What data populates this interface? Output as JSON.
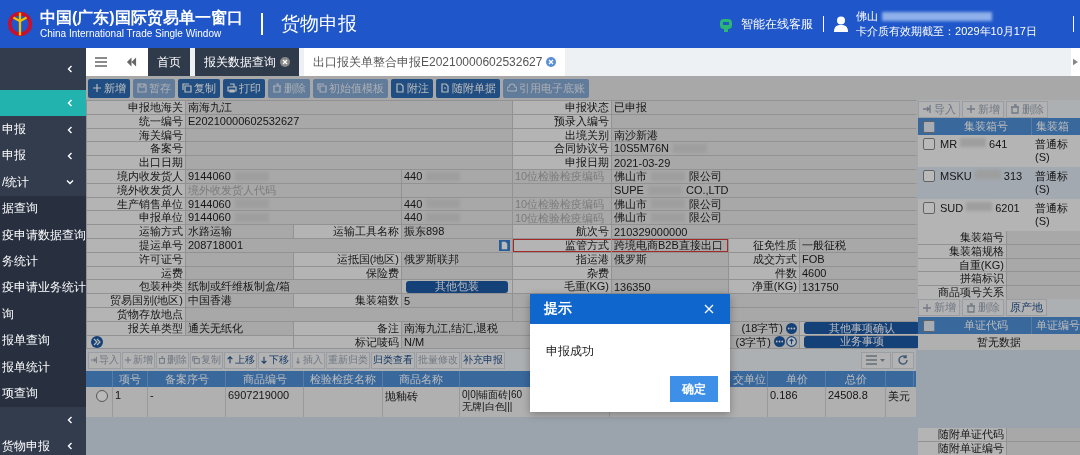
{
  "header": {
    "title": "中国(广东)国际贸易单一窗口",
    "subtitle": "China International Trade Single Window",
    "module": "货物申报",
    "service": "智能在线客服",
    "user": "佛山",
    "user_redacted": true,
    "card_expiry": "卡介质有效期截至：2029年10月17日"
  },
  "sidebar": {
    "items": [
      {
        "selected": false,
        "expanded": false
      },
      {
        "selected": true,
        "expanded": false
      },
      {
        "label": "申报",
        "selected": false,
        "expanded": false
      },
      {
        "label": "申报",
        "selected": false,
        "expanded": false
      },
      {
        "label": "/统计",
        "selected": false,
        "expanded": true,
        "children": [
          {
            "label": "据查询",
            "selected": false
          },
          {
            "label": "疫申请数据查询",
            "selected": false
          },
          {
            "label": "务统计",
            "selected": false
          },
          {
            "label": "疫申请业务统计",
            "selected": false
          },
          {
            "label": "询",
            "selected": false
          },
          {
            "label": "报单查询",
            "selected": false
          },
          {
            "label": "报单统计",
            "selected": false
          },
          {
            "label": "项查询",
            "selected": false
          }
        ]
      },
      {
        "selected": false,
        "expanded": false
      },
      {
        "label": "货物申报",
        "selected": false,
        "expanded": false
      }
    ]
  },
  "tabs": [
    {
      "label": "首页",
      "selected": false,
      "closable": false
    },
    {
      "label": "报关数据查询",
      "selected": false,
      "closable": true
    },
    {
      "label": "出口报关单整合申报E20210000602532627",
      "selected": true,
      "closable": true
    }
  ],
  "toolbar": [
    {
      "label": "新增",
      "disabled": false
    },
    {
      "label": "暂存",
      "disabled": true
    },
    {
      "label": "复制",
      "disabled": false
    },
    {
      "label": "打印",
      "disabled": false
    },
    {
      "label": "删除",
      "disabled": true
    },
    {
      "label": "初始值模板",
      "disabled": true
    },
    {
      "label": "附注",
      "disabled": false
    },
    {
      "label": "随附单据",
      "disabled": false
    },
    {
      "label": "引用电子底账",
      "disabled": true
    }
  ],
  "form": {
    "lines": [
      {
        "cells": [
          {
            "kind": "label",
            "text": "申报地海关"
          },
          {
            "kind": "field",
            "value": "南海九江"
          },
          {
            "kind": "label",
            "text": "申报状态"
          },
          {
            "kind": "field",
            "value": "已申报"
          }
        ]
      },
      {
        "cells": [
          {
            "kind": "label",
            "text": "统一编号"
          },
          {
            "kind": "field",
            "value": "E20210000602532627"
          },
          {
            "kind": "label",
            "text": "预录入编号"
          },
          {
            "kind": "field"
          }
        ]
      },
      {
        "cells": [
          {
            "kind": "label",
            "text": "海关编号"
          },
          {
            "kind": "field"
          },
          {
            "kind": "label",
            "text": "出境关别"
          },
          {
            "kind": "field",
            "value": "南沙新港"
          }
        ]
      },
      {
        "cells": [
          {
            "kind": "label",
            "text": "备案号"
          },
          {
            "kind": "field"
          },
          {
            "kind": "label",
            "text": "合同协议号"
          },
          {
            "kind": "field",
            "value": "10S5M76N",
            "redacted": true
          }
        ]
      },
      {
        "cells": [
          {
            "kind": "label",
            "text": "出口日期"
          },
          {
            "kind": "field"
          },
          {
            "kind": "label",
            "text": "申报日期"
          },
          {
            "kind": "field",
            "value": "2021-03-29"
          }
        ]
      },
      {
        "cells": [
          {
            "kind": "label",
            "text": "境内收发货人"
          },
          {
            "kind": "field",
            "value": "9144060",
            "redacted": true
          },
          {
            "kind": "field",
            "value": "440",
            "redacted": true
          },
          {
            "kind": "field",
            "placeholder": "10位检验检疫编码"
          },
          {
            "kind": "field",
            "value": "佛山市",
            "redacted": true,
            "value_end": "限公司"
          }
        ]
      },
      {
        "cells": [
          {
            "kind": "label",
            "text": "境外收发货人"
          },
          {
            "kind": "field",
            "placeholder": "境外收发货人代码"
          },
          {
            "kind": "field"
          },
          {
            "kind": "field"
          },
          {
            "kind": "field",
            "value": "SUPE",
            "redacted": true,
            "value_end": "CO.,LTD"
          }
        ]
      },
      {
        "cells": [
          {
            "kind": "label",
            "text": "生产销售单位"
          },
          {
            "kind": "field",
            "value": "9144060",
            "redacted": true
          },
          {
            "kind": "field",
            "value": "440",
            "redacted": true
          },
          {
            "kind": "field",
            "placeholder": "10位检验检疫编码"
          },
          {
            "kind": "field",
            "value": "佛山市",
            "redacted": true,
            "value_end": "限公司"
          }
        ]
      },
      {
        "cells": [
          {
            "kind": "label",
            "text": "申报单位"
          },
          {
            "kind": "field",
            "value": "9144060",
            "redacted": true
          },
          {
            "kind": "field",
            "value": "440",
            "redacted": true
          },
          {
            "kind": "field",
            "placeholder": "10位检验检疫编码"
          },
          {
            "kind": "field",
            "value": "佛山市",
            "redacted": true,
            "value_end": "限公司"
          }
        ]
      },
      {
        "cells": [
          {
            "kind": "label",
            "text": "运输方式"
          },
          {
            "kind": "field",
            "value": "水路运输"
          },
          {
            "kind": "label",
            "text": "运输工具名称"
          },
          {
            "kind": "field",
            "value": "振东898"
          },
          {
            "kind": "label",
            "text": "航次号"
          },
          {
            "kind": "field",
            "value": "210329000000"
          }
        ]
      },
      {
        "cells": [
          {
            "kind": "label",
            "text": "提运单号"
          },
          {
            "kind": "field",
            "value": "208718001"
          },
          {
            "kind": "label",
            "text": "监管方式",
            "highlighted": true
          },
          {
            "kind": "field",
            "value": "跨境电商B2B直接出口",
            "highlighted": true
          },
          {
            "kind": "label",
            "text": "征免性质"
          },
          {
            "kind": "field",
            "value": "一般征税"
          }
        ]
      },
      {
        "cells": [
          {
            "kind": "label",
            "text": "许可证号"
          },
          {
            "kind": "field"
          },
          {
            "kind": "label",
            "text": "运抵国(地区)"
          },
          {
            "kind": "field",
            "value": "俄罗斯联邦"
          },
          {
            "kind": "label",
            "text": "指运港"
          },
          {
            "kind": "field",
            "value": "俄罗斯"
          },
          {
            "kind": "label",
            "text": "成交方式"
          },
          {
            "kind": "field",
            "value": "FOB"
          }
        ]
      },
      {
        "cells": [
          {
            "kind": "label",
            "text": "运费"
          },
          {
            "kind": "field"
          },
          {
            "kind": "label",
            "text": "保险费"
          },
          {
            "kind": "field"
          },
          {
            "kind": "label",
            "text": "杂费"
          },
          {
            "kind": "field"
          },
          {
            "kind": "label",
            "text": "件数"
          },
          {
            "kind": "field",
            "value": "4600"
          }
        ]
      },
      {
        "cells": [
          {
            "kind": "label",
            "text": "包装种类"
          },
          {
            "kind": "field",
            "value": "纸制或纤维板制盒/箱"
          },
          {
            "kind": "button",
            "text": "其他包装"
          },
          {
            "kind": "label",
            "text": "毛重(KG)"
          },
          {
            "kind": "field",
            "value": "136350"
          },
          {
            "kind": "label",
            "text": "净重(KG)"
          },
          {
            "kind": "field",
            "value": "131750"
          }
        ]
      },
      {
        "cells": [
          {
            "kind": "label",
            "text": "贸易国别(地区)"
          },
          {
            "kind": "field",
            "value": "中国香港"
          },
          {
            "kind": "label",
            "text": "集装箱数"
          },
          {
            "kind": "field",
            "value": "5"
          },
          {
            "kind": "field"
          }
        ]
      },
      {
        "cells": [
          {
            "kind": "label",
            "text": "货物存放地点"
          },
          {
            "kind": "field"
          },
          {
            "kind": "field"
          }
        ]
      },
      {
        "cells": [
          {
            "kind": "label",
            "text": "报关单类型"
          },
          {
            "kind": "field",
            "value": "通关无纸化"
          },
          {
            "kind": "label",
            "text": "备注"
          },
          {
            "kind": "field",
            "value": "南海九江,结汇,退税",
            "note": "(18字节)"
          },
          {
            "kind": "button",
            "text": "其他事项确认"
          }
        ]
      },
      {
        "cells": [
          {
            "kind": "icon_button"
          },
          {
            "kind": "label",
            "text": "标记唛码"
          },
          {
            "kind": "field",
            "value": "N/M",
            "note": "(3字节)"
          },
          {
            "kind": "button",
            "text": "业务事项"
          }
        ]
      }
    ]
  },
  "goods_toolbar": [
    {
      "label": "导入",
      "disabled": true
    },
    {
      "label": "新增",
      "disabled": true
    },
    {
      "label": "删除",
      "disabled": true
    },
    {
      "label": "复制",
      "disabled": true
    },
    {
      "label": "上移",
      "disabled": false
    },
    {
      "label": "下移",
      "disabled": false
    },
    {
      "label": "插入",
      "disabled": true
    },
    {
      "label": "重新归类",
      "disabled": true
    },
    {
      "label": "归类查看",
      "disabled": false
    },
    {
      "label": "批量修改",
      "disabled": true
    },
    {
      "label": "补充申报",
      "disabled": false
    }
  ],
  "goods_table": {
    "columns": [
      "项号",
      "备案序号",
      "商品编号",
      "检验检疫名称",
      "商品名称",
      "交单位",
      "单价",
      "总价"
    ],
    "rows": [
      {
        "selected": false,
        "item_no": "1",
        "record_no": "-",
        "hs_code": "6907219000",
        "name": "抛釉砖",
        "spec": [
          "0|0|铺面砖|60",
          "无牌|白色|||"
        ],
        "unit_price": "0.186",
        "total": "24508.8",
        "currency": "美元"
      }
    ]
  },
  "containers": {
    "toolbar": [
      {
        "label": "导入",
        "disabled": true
      },
      {
        "label": "新增",
        "disabled": true
      },
      {
        "label": "删除",
        "disabled": true
      }
    ],
    "columns": [
      "集装箱号",
      "集装箱"
    ],
    "all_selected": false,
    "rows": [
      {
        "selected": false,
        "number": "MR",
        "number_end": "641",
        "spec": "普通标",
        "spec_end": "(S)"
      },
      {
        "selected": false,
        "number": "MSKU",
        "number_end": "313",
        "spec": "普通标",
        "spec_end": "(S)"
      },
      {
        "selected": false,
        "number": "SUD",
        "number_end": "6201",
        "spec": "普通标",
        "spec_end": "(S)"
      }
    ]
  },
  "container_form": [
    "集装箱号",
    "集装箱规格",
    "自重(KG)",
    "拼箱标识",
    "商品项号关系"
  ],
  "documents": {
    "toolbar": [
      {
        "label": "新增",
        "disabled": true
      },
      {
        "label": "删除",
        "disabled": true
      },
      {
        "label": "原产地",
        "disabled": false
      }
    ],
    "columns": [
      "单证代码",
      "单证编号"
    ],
    "all_selected": false,
    "empty_text": "暂无数据"
  },
  "document_form": [
    "随附单证代码",
    "随附单证编号"
  ],
  "dialog": {
    "title": "提示",
    "message": "申报成功",
    "button": "确定"
  }
}
